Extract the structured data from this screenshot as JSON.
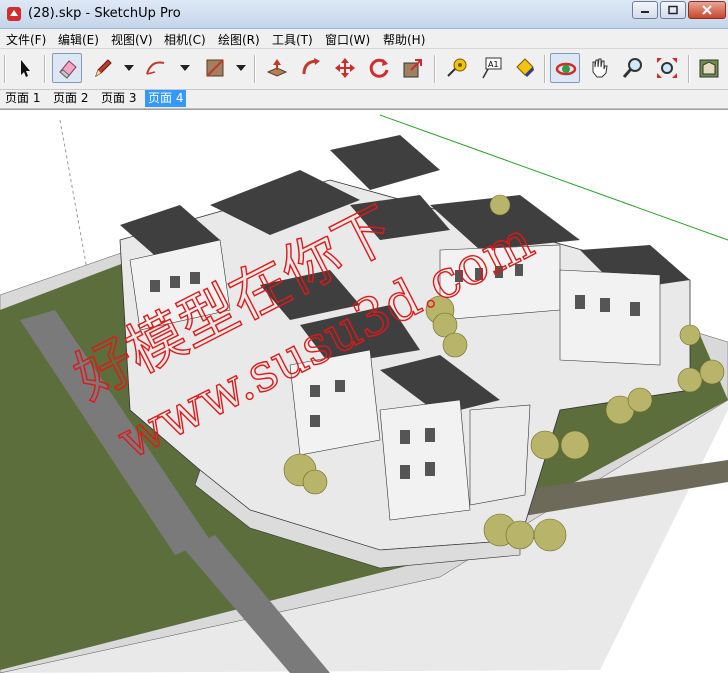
{
  "window": {
    "title": "(28).skp - SketchUp Pro"
  },
  "menu": [
    "文件(F)",
    "编辑(E)",
    "视图(V)",
    "相机(C)",
    "绘图(R)",
    "工具(T)",
    "窗口(W)",
    "帮助(H)"
  ],
  "toolbar": {
    "tools": [
      {
        "name": "select-tool",
        "icon": "arrow-cursor-icon"
      },
      {
        "name": "eraser-tool",
        "icon": "eraser-icon",
        "active": true
      },
      {
        "name": "line-tool",
        "icon": "pencil-icon"
      },
      {
        "name": "arc-tool",
        "icon": "arc-icon"
      },
      {
        "name": "rectangle-tool",
        "icon": "rectangle-icon"
      },
      {
        "name": "push-pull-tool",
        "icon": "push-pull-icon"
      },
      {
        "name": "follow-me-tool",
        "icon": "follow-me-icon"
      },
      {
        "name": "move-tool",
        "icon": "move-icon"
      },
      {
        "name": "rotate-tool",
        "icon": "rotate-icon"
      },
      {
        "name": "scale-tool",
        "icon": "scale-icon"
      },
      {
        "name": "tape-measure-tool",
        "icon": "tape-measure-icon"
      },
      {
        "name": "text-tool",
        "icon": "text-label-icon"
      },
      {
        "name": "paint-bucket-tool",
        "icon": "paint-bucket-icon"
      },
      {
        "name": "orbit-tool",
        "icon": "orbit-icon",
        "active": true
      },
      {
        "name": "pan-tool",
        "icon": "hand-icon"
      },
      {
        "name": "zoom-tool",
        "icon": "magnifier-icon"
      },
      {
        "name": "zoom-extents-tool",
        "icon": "zoom-extents-icon"
      },
      {
        "name": "warehouse-tool",
        "icon": "warehouse-icon"
      }
    ],
    "text_tool_label": "A1"
  },
  "scene_tabs": [
    {
      "label": "页面 1",
      "active": false
    },
    {
      "label": "页面 2",
      "active": false
    },
    {
      "label": "页面 3",
      "active": false
    },
    {
      "label": "页面 4",
      "active": true
    }
  ],
  "watermark": {
    "line1": "好模型在你下",
    "line2": "www.susu3d.com"
  },
  "colors": {
    "lawn": "#5c6e3c",
    "road": "#7a7a7a",
    "roof": "#3f3f3f",
    "wall": "#f2f2f2",
    "watermark": "#e01818",
    "active_tab": "#3399ff"
  }
}
